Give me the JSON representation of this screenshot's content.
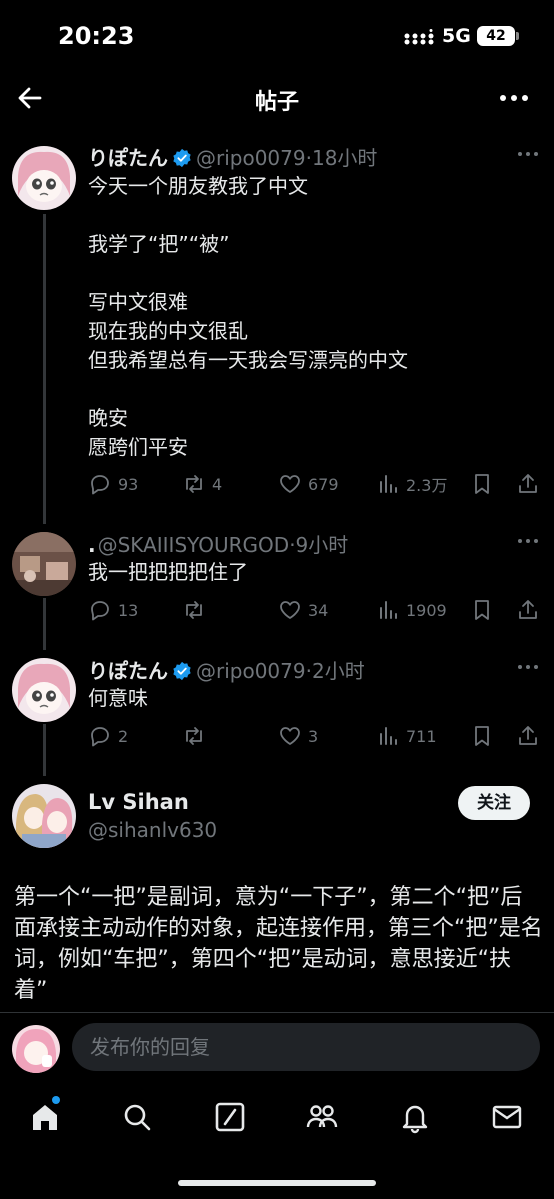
{
  "status_bar": {
    "time": "20:23",
    "network": "5G",
    "battery": "42"
  },
  "header": {
    "title": "帖子"
  },
  "thread": [
    {
      "name": "りぽたん",
      "handle": "@ripo0079",
      "time": "·18小时",
      "verified": true,
      "text": "今天一个朋友教我了中文\n\n我学了“把”“被”\n\n写中文很难\n现在我的中文很乱\n但我希望总有一天我会写漂亮的中文\n\n晚安\n愿跨们平安",
      "replies": "93",
      "reposts": "4",
      "likes": "679",
      "views": "2.3万"
    },
    {
      "name": ".",
      "handle": "@SKAIIISYOURGOD",
      "time": "·9小时",
      "verified": false,
      "text": "我一把把把把住了",
      "replies": "13",
      "reposts": "",
      "likes": "34",
      "views": "1909"
    },
    {
      "name": "りぽたん",
      "handle": "@ripo0079",
      "time": "·2小时",
      "verified": true,
      "text": "何意味",
      "replies": "2",
      "reposts": "",
      "likes": "3",
      "views": "711"
    }
  ],
  "main_reply": {
    "name": "Lv Sihan",
    "handle": "@sihanlv630",
    "follow_label": "关注",
    "text": "第一个“一把”是副词，意为“一下子”，第二个“把”后面承接主动动作的对象，起连接作用，第三个“把”是名词，例如“车把”，第四个“把”是动词，意思接近“扶着”"
  },
  "reply_bar": {
    "placeholder": "发布你的回复"
  },
  "tabs": [
    "home",
    "search",
    "grok",
    "communities",
    "notifications",
    "messages"
  ],
  "colors": {
    "accent": "#1d9bf0",
    "background": "#000000",
    "muted": "#71767b"
  }
}
